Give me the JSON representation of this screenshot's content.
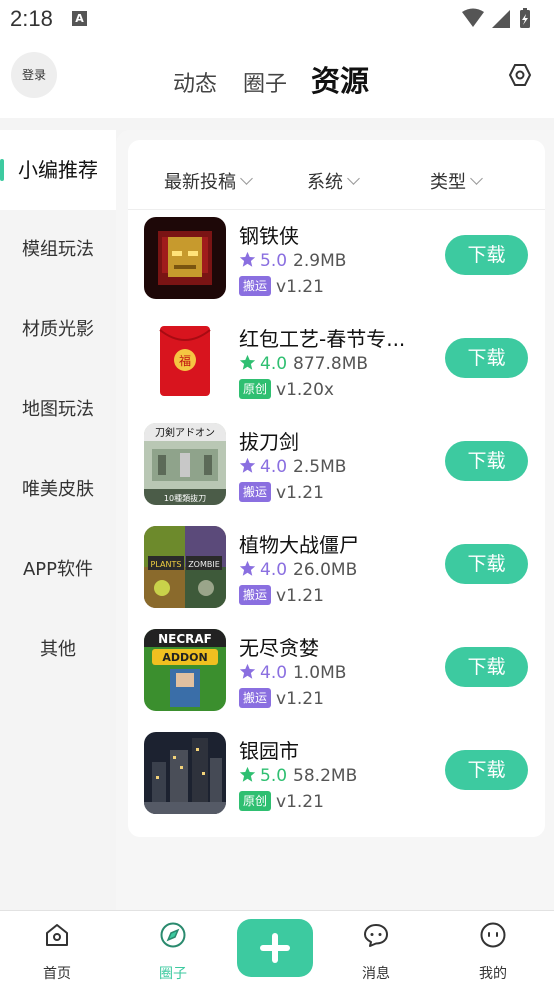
{
  "status_bar": {
    "time": "2:18",
    "notification_glyph": "A"
  },
  "header": {
    "login_label": "登录",
    "tabs": [
      {
        "label": "动态"
      },
      {
        "label": "圈子"
      },
      {
        "label": "资源"
      }
    ],
    "settings_icon": "hexagon-settings-icon"
  },
  "sidebar": {
    "items": [
      {
        "label": "小编推荐"
      },
      {
        "label": "模组玩法"
      },
      {
        "label": "材质光影"
      },
      {
        "label": "地图玩法"
      },
      {
        "label": "唯美皮肤"
      },
      {
        "label": "APP软件"
      },
      {
        "label": "其他"
      }
    ],
    "active_index": 0
  },
  "filters": [
    {
      "label": "最新投稿"
    },
    {
      "label": "系统"
    },
    {
      "label": "类型"
    }
  ],
  "resources": [
    {
      "title": "钢铁侠",
      "score": "5.0",
      "size": "2.9MB",
      "badge": "搬运",
      "version": "v1.21",
      "download": "下载"
    },
    {
      "title": "红包工艺-春节专...",
      "score": "4.0",
      "size": "877.8MB",
      "badge": "原创",
      "version": "v1.20x",
      "download": "下载"
    },
    {
      "title": "拔刀剑",
      "score": "4.0",
      "size": "2.5MB",
      "badge": "搬运",
      "version": "v1.21",
      "download": "下载"
    },
    {
      "title": "植物大战僵尸",
      "score": "4.0",
      "size": "26.0MB",
      "badge": "搬运",
      "version": "v1.21",
      "download": "下载"
    },
    {
      "title": "无尽贪婪",
      "score": "4.0",
      "size": "1.0MB",
      "badge": "搬运",
      "version": "v1.21",
      "download": "下载"
    },
    {
      "title": "银园市",
      "score": "5.0",
      "size": "58.2MB",
      "badge": "原创",
      "version": "v1.21",
      "download": "下载"
    }
  ],
  "thumb_text": {
    "blade": "刀剣アドオン",
    "blade_sub": "10種類抜刀",
    "pvz_1": "PLANTS",
    "pvz_2": "ZOMBIE",
    "infinity_1": "NECRAF",
    "infinity_2": "ADDON",
    "redpacket": "福"
  },
  "colors": {
    "accent": "#3dcaa0",
    "badge_repost": "#8a6fe0",
    "badge_original": "#2fbf71",
    "star_purple": "#8a6fe0",
    "star_green": "#2fbf71"
  },
  "bottom_nav": [
    {
      "label": "首页",
      "icon": "home-icon"
    },
    {
      "label": "圈子",
      "icon": "compass-icon"
    },
    {
      "label": "",
      "icon": "plus-icon"
    },
    {
      "label": "消息",
      "icon": "chat-icon"
    },
    {
      "label": "我的",
      "icon": "face-icon"
    }
  ]
}
